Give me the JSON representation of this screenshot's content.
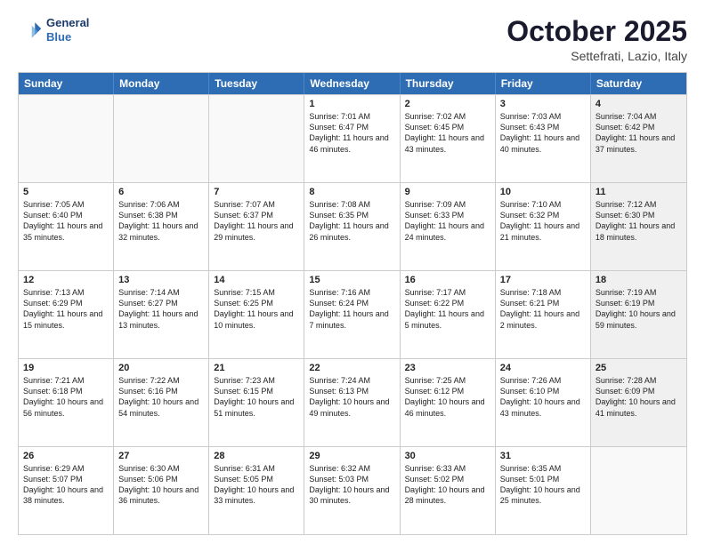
{
  "header": {
    "logo_line1": "General",
    "logo_line2": "Blue",
    "month": "October 2025",
    "location": "Settefrati, Lazio, Italy"
  },
  "days_of_week": [
    "Sunday",
    "Monday",
    "Tuesday",
    "Wednesday",
    "Thursday",
    "Friday",
    "Saturday"
  ],
  "weeks": [
    [
      {
        "day": "",
        "text": "",
        "shaded": false,
        "empty": true
      },
      {
        "day": "",
        "text": "",
        "shaded": false,
        "empty": true
      },
      {
        "day": "",
        "text": "",
        "shaded": false,
        "empty": true
      },
      {
        "day": "1",
        "text": "Sunrise: 7:01 AM\nSunset: 6:47 PM\nDaylight: 11 hours and 46 minutes.",
        "shaded": false,
        "empty": false
      },
      {
        "day": "2",
        "text": "Sunrise: 7:02 AM\nSunset: 6:45 PM\nDaylight: 11 hours and 43 minutes.",
        "shaded": false,
        "empty": false
      },
      {
        "day": "3",
        "text": "Sunrise: 7:03 AM\nSunset: 6:43 PM\nDaylight: 11 hours and 40 minutes.",
        "shaded": false,
        "empty": false
      },
      {
        "day": "4",
        "text": "Sunrise: 7:04 AM\nSunset: 6:42 PM\nDaylight: 11 hours and 37 minutes.",
        "shaded": true,
        "empty": false
      }
    ],
    [
      {
        "day": "5",
        "text": "Sunrise: 7:05 AM\nSunset: 6:40 PM\nDaylight: 11 hours and 35 minutes.",
        "shaded": false,
        "empty": false
      },
      {
        "day": "6",
        "text": "Sunrise: 7:06 AM\nSunset: 6:38 PM\nDaylight: 11 hours and 32 minutes.",
        "shaded": false,
        "empty": false
      },
      {
        "day": "7",
        "text": "Sunrise: 7:07 AM\nSunset: 6:37 PM\nDaylight: 11 hours and 29 minutes.",
        "shaded": false,
        "empty": false
      },
      {
        "day": "8",
        "text": "Sunrise: 7:08 AM\nSunset: 6:35 PM\nDaylight: 11 hours and 26 minutes.",
        "shaded": false,
        "empty": false
      },
      {
        "day": "9",
        "text": "Sunrise: 7:09 AM\nSunset: 6:33 PM\nDaylight: 11 hours and 24 minutes.",
        "shaded": false,
        "empty": false
      },
      {
        "day": "10",
        "text": "Sunrise: 7:10 AM\nSunset: 6:32 PM\nDaylight: 11 hours and 21 minutes.",
        "shaded": false,
        "empty": false
      },
      {
        "day": "11",
        "text": "Sunrise: 7:12 AM\nSunset: 6:30 PM\nDaylight: 11 hours and 18 minutes.",
        "shaded": true,
        "empty": false
      }
    ],
    [
      {
        "day": "12",
        "text": "Sunrise: 7:13 AM\nSunset: 6:29 PM\nDaylight: 11 hours and 15 minutes.",
        "shaded": false,
        "empty": false
      },
      {
        "day": "13",
        "text": "Sunrise: 7:14 AM\nSunset: 6:27 PM\nDaylight: 11 hours and 13 minutes.",
        "shaded": false,
        "empty": false
      },
      {
        "day": "14",
        "text": "Sunrise: 7:15 AM\nSunset: 6:25 PM\nDaylight: 11 hours and 10 minutes.",
        "shaded": false,
        "empty": false
      },
      {
        "day": "15",
        "text": "Sunrise: 7:16 AM\nSunset: 6:24 PM\nDaylight: 11 hours and 7 minutes.",
        "shaded": false,
        "empty": false
      },
      {
        "day": "16",
        "text": "Sunrise: 7:17 AM\nSunset: 6:22 PM\nDaylight: 11 hours and 5 minutes.",
        "shaded": false,
        "empty": false
      },
      {
        "day": "17",
        "text": "Sunrise: 7:18 AM\nSunset: 6:21 PM\nDaylight: 11 hours and 2 minutes.",
        "shaded": false,
        "empty": false
      },
      {
        "day": "18",
        "text": "Sunrise: 7:19 AM\nSunset: 6:19 PM\nDaylight: 10 hours and 59 minutes.",
        "shaded": true,
        "empty": false
      }
    ],
    [
      {
        "day": "19",
        "text": "Sunrise: 7:21 AM\nSunset: 6:18 PM\nDaylight: 10 hours and 56 minutes.",
        "shaded": false,
        "empty": false
      },
      {
        "day": "20",
        "text": "Sunrise: 7:22 AM\nSunset: 6:16 PM\nDaylight: 10 hours and 54 minutes.",
        "shaded": false,
        "empty": false
      },
      {
        "day": "21",
        "text": "Sunrise: 7:23 AM\nSunset: 6:15 PM\nDaylight: 10 hours and 51 minutes.",
        "shaded": false,
        "empty": false
      },
      {
        "day": "22",
        "text": "Sunrise: 7:24 AM\nSunset: 6:13 PM\nDaylight: 10 hours and 49 minutes.",
        "shaded": false,
        "empty": false
      },
      {
        "day": "23",
        "text": "Sunrise: 7:25 AM\nSunset: 6:12 PM\nDaylight: 10 hours and 46 minutes.",
        "shaded": false,
        "empty": false
      },
      {
        "day": "24",
        "text": "Sunrise: 7:26 AM\nSunset: 6:10 PM\nDaylight: 10 hours and 43 minutes.",
        "shaded": false,
        "empty": false
      },
      {
        "day": "25",
        "text": "Sunrise: 7:28 AM\nSunset: 6:09 PM\nDaylight: 10 hours and 41 minutes.",
        "shaded": true,
        "empty": false
      }
    ],
    [
      {
        "day": "26",
        "text": "Sunrise: 6:29 AM\nSunset: 5:07 PM\nDaylight: 10 hours and 38 minutes.",
        "shaded": false,
        "empty": false
      },
      {
        "day": "27",
        "text": "Sunrise: 6:30 AM\nSunset: 5:06 PM\nDaylight: 10 hours and 36 minutes.",
        "shaded": false,
        "empty": false
      },
      {
        "day": "28",
        "text": "Sunrise: 6:31 AM\nSunset: 5:05 PM\nDaylight: 10 hours and 33 minutes.",
        "shaded": false,
        "empty": false
      },
      {
        "day": "29",
        "text": "Sunrise: 6:32 AM\nSunset: 5:03 PM\nDaylight: 10 hours and 30 minutes.",
        "shaded": false,
        "empty": false
      },
      {
        "day": "30",
        "text": "Sunrise: 6:33 AM\nSunset: 5:02 PM\nDaylight: 10 hours and 28 minutes.",
        "shaded": false,
        "empty": false
      },
      {
        "day": "31",
        "text": "Sunrise: 6:35 AM\nSunset: 5:01 PM\nDaylight: 10 hours and 25 minutes.",
        "shaded": false,
        "empty": false
      },
      {
        "day": "",
        "text": "",
        "shaded": true,
        "empty": true
      }
    ]
  ]
}
